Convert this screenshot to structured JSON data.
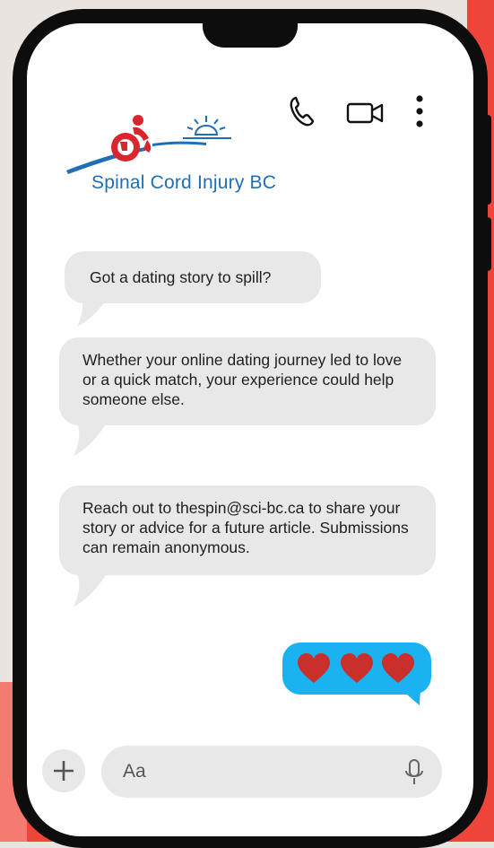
{
  "colors": {
    "background": "#e9e4df",
    "accent_red": "#f0453a",
    "incoming_bubble": "#e8e8e8",
    "outgoing_bubble": "#1ab2f0",
    "heart": "#c9302c",
    "logo_blue": "#1f6fb6",
    "logo_red": "#d9262c"
  },
  "header": {
    "icons": [
      "phone-icon",
      "video-icon",
      "more-vertical-icon"
    ]
  },
  "logo": {
    "text": "Spinal Cord Injury BC"
  },
  "messages": [
    {
      "text": "Got a dating story to spill?"
    },
    {
      "text": "Whether your online dating journey led to love or a quick match, your experience could help someone else."
    },
    {
      "text": "Reach out to thespin@sci-bc.ca to share your story or advice for a future article. Submissions can remain anonymous."
    }
  ],
  "reply": {
    "icons": [
      "heart-icon",
      "heart-icon",
      "heart-icon"
    ]
  },
  "composer": {
    "placeholder": "Aa",
    "icons": [
      "plus-icon",
      "microphone-icon"
    ]
  }
}
